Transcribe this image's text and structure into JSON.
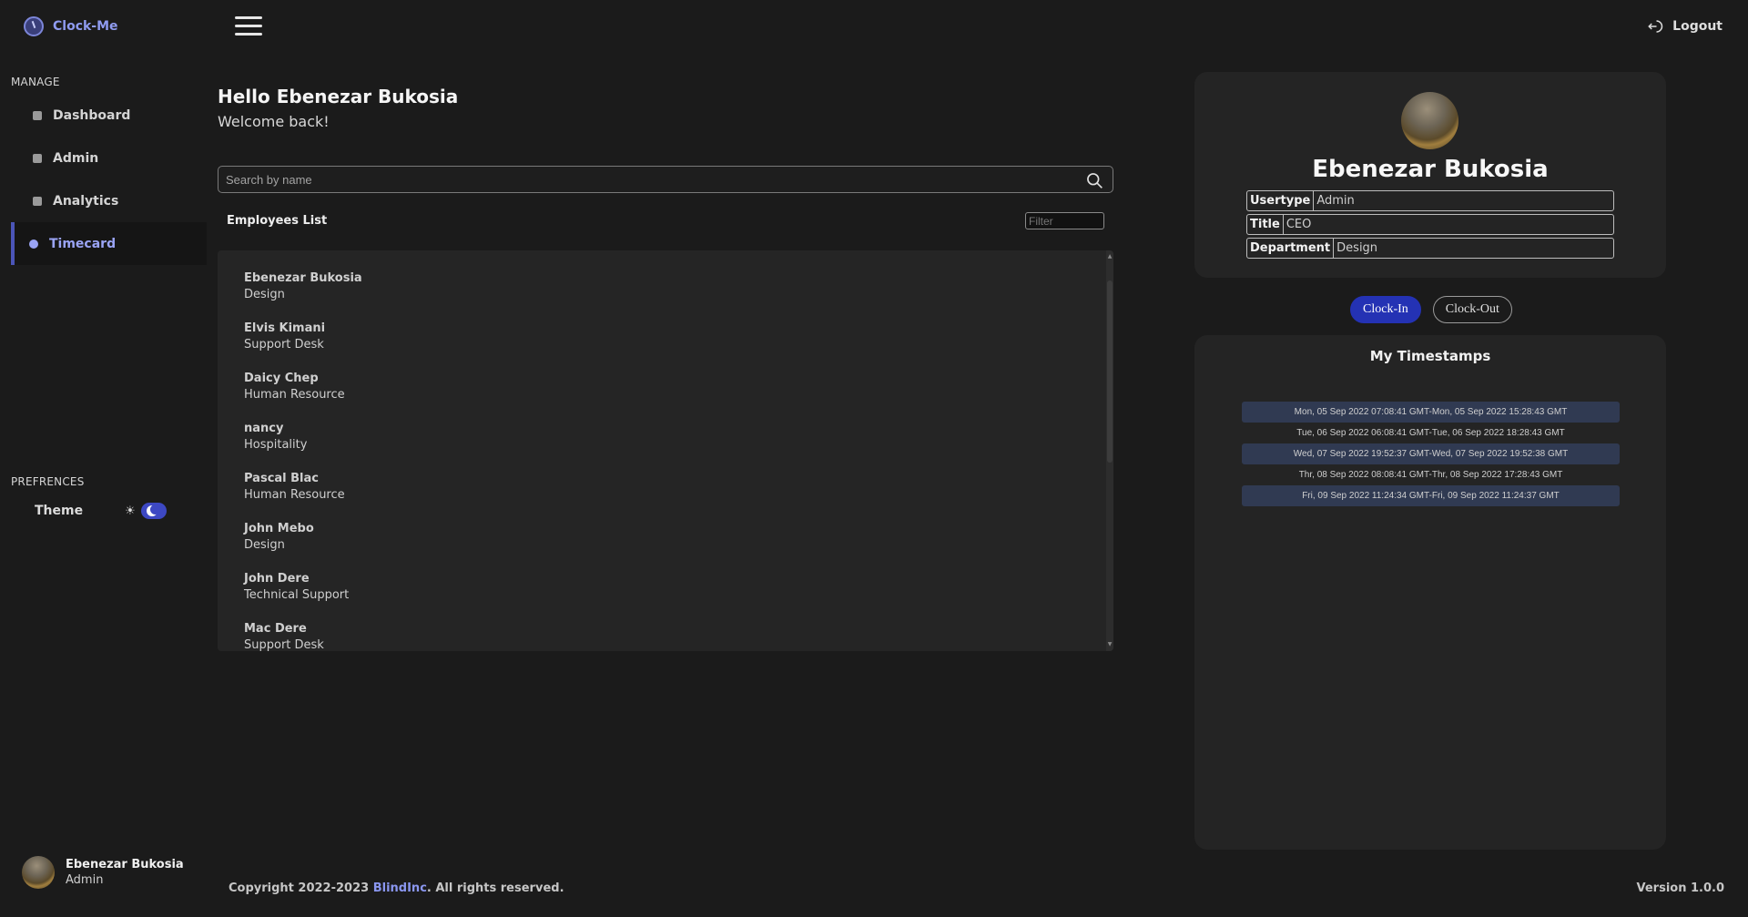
{
  "app": {
    "name": "Clock-Me",
    "logout_label": "Logout",
    "version_label": "Version 1.0.0"
  },
  "sidebar": {
    "manage_label": "MANAGE",
    "items": [
      {
        "label": "Dashboard",
        "icon": "dashboard-icon",
        "active": false
      },
      {
        "label": "Admin",
        "icon": "admin-icon",
        "active": false
      },
      {
        "label": "Analytics",
        "icon": "analytics-icon",
        "active": false
      },
      {
        "label": "Timecard",
        "icon": "clock-icon",
        "active": true
      }
    ],
    "preferences_label": "PREFRENCES",
    "theme_label": "Theme",
    "theme_mode": "dark",
    "user": {
      "name": "Ebenezar Bukosia",
      "role": "Admin"
    }
  },
  "main": {
    "greeting": "Hello Ebenezar Bukosia",
    "welcome": "Welcome back!",
    "search_placeholder": "Search by name",
    "employees_title": "Employees List",
    "filter_placeholder": "Filter",
    "employees": [
      {
        "name": "Ebenezar Bukosia",
        "department": "Design"
      },
      {
        "name": "Elvis Kimani",
        "department": "Support Desk"
      },
      {
        "name": "Daicy Chep",
        "department": "Human Resource"
      },
      {
        "name": "nancy",
        "department": "Hospitality"
      },
      {
        "name": "Pascal Blac",
        "department": "Human Resource"
      },
      {
        "name": "John Mebo",
        "department": "Design"
      },
      {
        "name": "John Dere",
        "department": "Technical Support"
      },
      {
        "name": "Mac Dere",
        "department": "Support Desk"
      }
    ],
    "footer": {
      "prefix": "Copyright 2022-2023 ",
      "brand": "BlindInc",
      "suffix": ". All rights reserved."
    }
  },
  "profile": {
    "name": "Ebenezar Bukosia",
    "fields": [
      {
        "key": "Usertype",
        "value": "Admin"
      },
      {
        "key": "Title",
        "value": "CEO"
      },
      {
        "key": "Department",
        "value": "Design"
      }
    ],
    "clock_in_label": "Clock-In",
    "clock_out_label": "Clock-Out"
  },
  "timestamps": {
    "title": "My Timestamps",
    "entries": [
      "Mon, 05 Sep 2022 07:08:41 GMT-Mon, 05 Sep 2022 15:28:43 GMT",
      "Tue, 06 Sep 2022 06:08:41 GMT-Tue, 06 Sep 2022 18:28:43 GMT",
      "Wed, 07 Sep 2022 19:52:37 GMT-Wed, 07 Sep 2022 19:52:38 GMT",
      "Thr, 08 Sep 2022 08:08:41 GMT-Thr, 08 Sep 2022 17:28:43 GMT",
      "Fri, 09 Sep 2022 11:24:34 GMT-Fri, 09 Sep 2022 11:24:37 GMT"
    ]
  },
  "colors": {
    "accent": "#2432b4",
    "accent_text": "#8f9bf0",
    "background": "#1b1b1b",
    "card": "#242424",
    "row_shade": "#303a52"
  }
}
